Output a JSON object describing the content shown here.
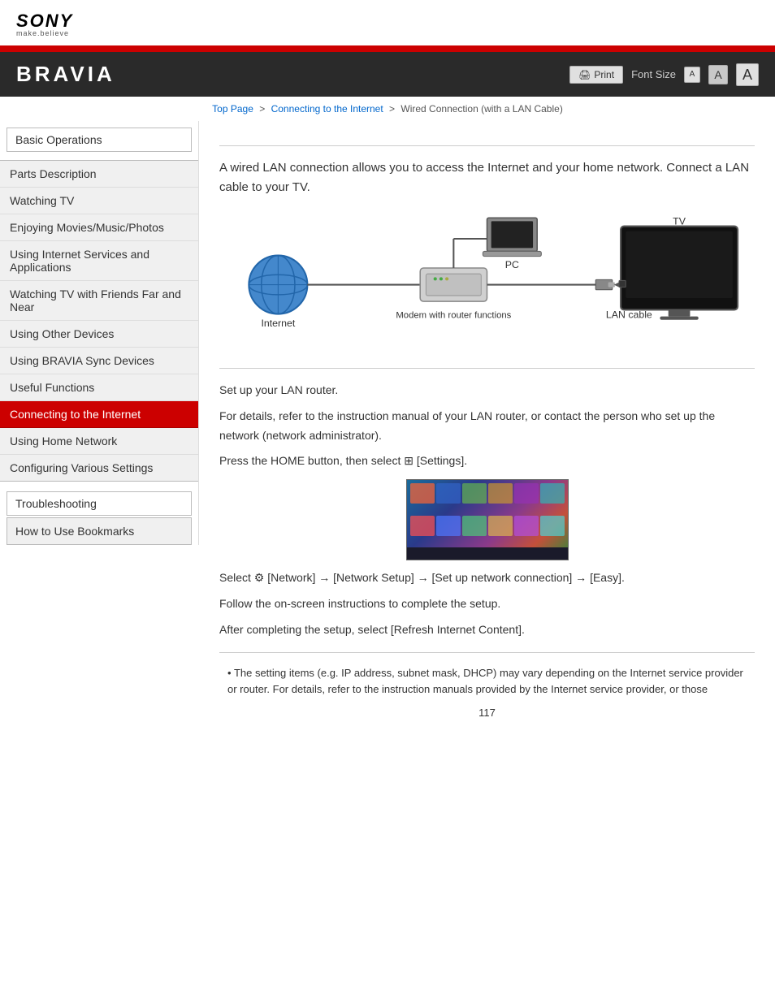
{
  "header": {
    "sony_text": "SONY",
    "tagline": "make.believe",
    "bravia_title": "BRAVIA",
    "print_label": "Print",
    "font_size_label": "Font Size",
    "font_small": "A",
    "font_medium": "A",
    "font_large": "A"
  },
  "breadcrumb": {
    "top_page": "Top Page",
    "sep1": ">",
    "connecting": "Connecting to the Internet",
    "sep2": ">",
    "current": "Wired Connection (with a LAN Cable)"
  },
  "sidebar": {
    "items": [
      {
        "id": "basic-operations",
        "label": "Basic Operations",
        "active": false,
        "type": "header"
      },
      {
        "id": "parts-description",
        "label": "Parts Description",
        "active": false
      },
      {
        "id": "watching-tv",
        "label": "Watching TV",
        "active": false
      },
      {
        "id": "enjoying-movies",
        "label": "Enjoying Movies/Music/Photos",
        "active": false
      },
      {
        "id": "using-internet",
        "label": "Using Internet Services and Applications",
        "active": false
      },
      {
        "id": "watching-friends",
        "label": "Watching TV with Friends Far and Near",
        "active": false
      },
      {
        "id": "using-other",
        "label": "Using Other Devices",
        "active": false
      },
      {
        "id": "using-bravia",
        "label": "Using BRAVIA Sync Devices",
        "active": false
      },
      {
        "id": "useful-functions",
        "label": "Useful Functions",
        "active": false
      },
      {
        "id": "connecting-internet",
        "label": "Connecting to the Internet",
        "active": true
      },
      {
        "id": "using-home",
        "label": "Using Home Network",
        "active": false
      },
      {
        "id": "configuring",
        "label": "Configuring Various Settings",
        "active": false
      },
      {
        "id": "divider",
        "label": "",
        "type": "divider"
      },
      {
        "id": "troubleshooting",
        "label": "Troubleshooting",
        "active": false,
        "type": "header"
      },
      {
        "id": "how-to-use",
        "label": "How to Use Bookmarks",
        "active": false
      }
    ]
  },
  "content": {
    "title": "Wired Connection (with a LAN Cable)",
    "intro": "A wired LAN connection allows you to access the Internet and your home network. Connect a LAN cable to your TV.",
    "diagram": {
      "internet_label": "Internet",
      "pc_label": "PC",
      "modem_label": "Modem with router functions",
      "lan_label": "LAN cable",
      "tv_label": "TV"
    },
    "steps": [
      "Set up your LAN router.",
      "For details, refer to the instruction manual of your LAN router, or contact the person who set up the network (network administrator).",
      "Press the HOME button, then select  [Settings].",
      "Select  [Network] → [Network Setup] → [Set up network connection] → [Easy].",
      "Follow the on-screen instructions to complete the setup.",
      "After completing the setup, select [Refresh Internet Content]."
    ],
    "note": "The setting items (e.g. IP address, subnet mask, DHCP) may vary depending on the Internet service provider or router. For details, refer to the instruction manuals provided by the Internet service provider, or those",
    "page_number": "117"
  }
}
